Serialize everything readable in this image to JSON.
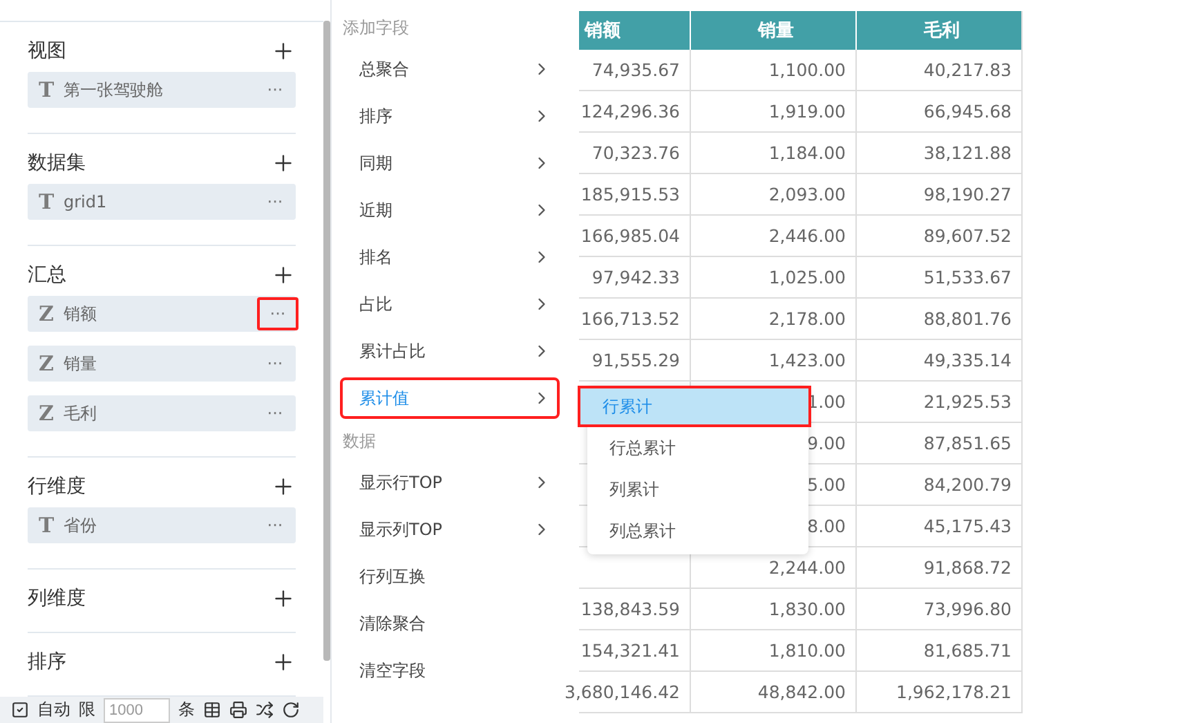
{
  "sidebar": {
    "sections": [
      {
        "title": "视图",
        "fields": [
          {
            "glyph": "T",
            "name": "第一张驾驶舱",
            "more": "···",
            "highlighted": false
          }
        ]
      },
      {
        "title": "数据集",
        "fields": [
          {
            "glyph": "T",
            "name": "grid1",
            "more": "···",
            "highlighted": false
          }
        ]
      },
      {
        "title": "汇总",
        "fields": [
          {
            "glyph": "Z",
            "name": "销额",
            "more": "···",
            "highlighted": true
          },
          {
            "glyph": "Z",
            "name": "销量",
            "more": "···",
            "highlighted": false
          },
          {
            "glyph": "Z",
            "name": "毛利",
            "more": "···",
            "highlighted": false
          }
        ]
      },
      {
        "title": "行维度",
        "fields": [
          {
            "glyph": "T",
            "name": "省份",
            "more": "···",
            "highlighted": false
          }
        ]
      },
      {
        "title": "列维度"
      },
      {
        "title": "排序"
      }
    ]
  },
  "toolbar": {
    "auto_checked": true,
    "auto_label": "自动",
    "limit_label": "限",
    "limit_value": "1000",
    "unit": "条"
  },
  "menu": {
    "groups": [
      {
        "header": "添加字段",
        "items": [
          {
            "label": "总聚合",
            "submenu": true,
            "selected": false,
            "highlighted": false
          },
          {
            "label": "排序",
            "submenu": true,
            "selected": false,
            "highlighted": false
          },
          {
            "label": "同期",
            "submenu": true,
            "selected": false,
            "highlighted": false
          },
          {
            "label": "近期",
            "submenu": true,
            "selected": false,
            "highlighted": false
          },
          {
            "label": "排名",
            "submenu": true,
            "selected": false,
            "highlighted": false
          },
          {
            "label": "占比",
            "submenu": true,
            "selected": false,
            "highlighted": false
          },
          {
            "label": "累计占比",
            "submenu": true,
            "selected": false,
            "highlighted": false
          },
          {
            "label": "累计值",
            "submenu": true,
            "selected": true,
            "highlighted": true
          }
        ]
      },
      {
        "header": "数据",
        "items": [
          {
            "label": "显示行TOP",
            "submenu": true,
            "selected": false,
            "highlighted": false
          },
          {
            "label": "显示列TOP",
            "submenu": true,
            "selected": false,
            "highlighted": false
          },
          {
            "label": "行列互换",
            "submenu": false,
            "selected": false,
            "highlighted": false
          },
          {
            "label": "清除聚合",
            "submenu": false,
            "selected": false,
            "highlighted": false
          },
          {
            "label": "清空字段",
            "submenu": false,
            "selected": false,
            "highlighted": false
          }
        ]
      }
    ]
  },
  "submenu": {
    "items": [
      {
        "label": "行累计",
        "selected": true,
        "highlighted": true
      },
      {
        "label": "行总累计",
        "selected": false,
        "highlighted": false
      },
      {
        "label": "列累计",
        "selected": false,
        "highlighted": false
      },
      {
        "label": "列总累计",
        "selected": false,
        "highlighted": false
      }
    ]
  },
  "table": {
    "columns": [
      "销额",
      "销量",
      "毛利"
    ],
    "rows": [
      [
        "74,935.67",
        "1,100.00",
        "40,217.83"
      ],
      [
        "124,296.36",
        "1,919.00",
        "66,945.68"
      ],
      [
        "70,323.76",
        "1,184.00",
        "38,121.88"
      ],
      [
        "185,915.53",
        "2,093.00",
        "98,190.27"
      ],
      [
        "166,985.04",
        "2,446.00",
        "89,607.52"
      ],
      [
        "97,942.33",
        "1,025.00",
        "51,533.67"
      ],
      [
        "166,713.52",
        "2,178.00",
        "88,801.76"
      ],
      [
        "91,555.29",
        "1,423.00",
        "49,335.14"
      ],
      [
        "",
        "1.00",
        "21,925.53"
      ],
      [
        "",
        "9.00",
        "87,851.65"
      ],
      [
        "",
        "5.00",
        "84,200.79"
      ],
      [
        "",
        "8.00",
        "45,175.43"
      ],
      [
        "",
        "2,244.00",
        "91,868.72"
      ],
      [
        "138,843.59",
        "1,830.00",
        "73,996.80"
      ],
      [
        "154,321.41",
        "1,810.00",
        "81,685.71"
      ],
      [
        "3,680,146.42",
        "48,842.00",
        "1,962,178.21"
      ]
    ]
  }
}
